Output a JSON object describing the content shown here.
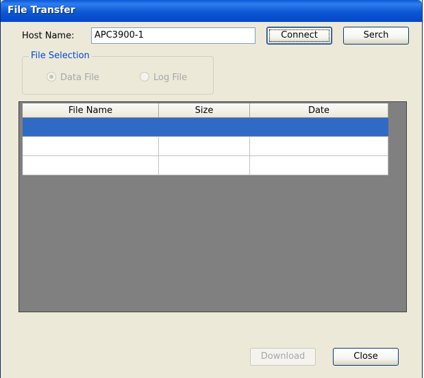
{
  "window": {
    "title": "File Transfer"
  },
  "host": {
    "label": "Host Name:",
    "value": "APC3900-1"
  },
  "buttons": {
    "connect": "Connect",
    "search": "Serch",
    "download": "Download",
    "close": "Close"
  },
  "file_selection": {
    "legend": "File Selection",
    "options": [
      {
        "label": "Data File",
        "selected": true,
        "enabled": false
      },
      {
        "label": "Log File",
        "selected": false,
        "enabled": false
      }
    ]
  },
  "table": {
    "columns": [
      "File Name",
      "Size",
      "Date"
    ],
    "rows": [
      [
        "",
        "",
        ""
      ],
      [
        "",
        "",
        ""
      ],
      [
        "",
        "",
        ""
      ]
    ],
    "selected_row": 0
  }
}
